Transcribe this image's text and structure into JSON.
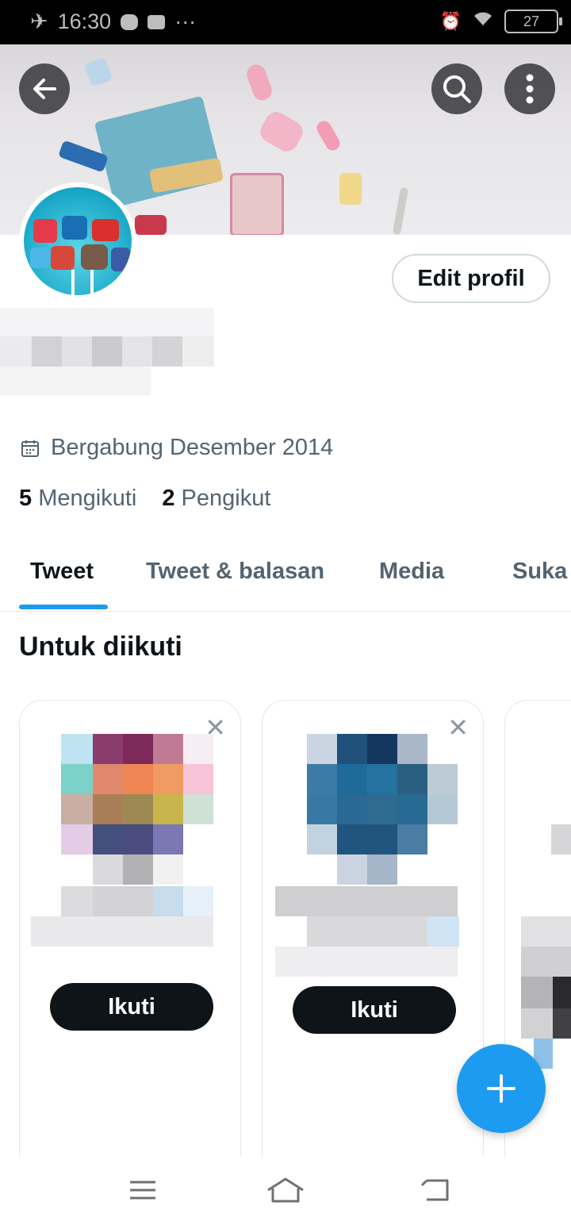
{
  "status_bar": {
    "time": "16:30",
    "dots": "···",
    "battery": "27"
  },
  "header": {
    "edit_profile_label": "Edit profil"
  },
  "profile": {
    "joined": "Bergabung Desember 2014",
    "following_count": "5",
    "following_label": "Mengikuti",
    "followers_count": "2",
    "followers_label": "Pengikut"
  },
  "tabs": [
    {
      "label": "Tweet",
      "active": true
    },
    {
      "label": "Tweet & balasan",
      "active": false
    },
    {
      "label": "Media",
      "active": false
    },
    {
      "label": "Suka",
      "active": false
    }
  ],
  "suggestions": {
    "title": "Untuk diikuti",
    "cards": [
      {
        "follow_label": "Ikuti",
        "close": "✕"
      },
      {
        "follow_label": "Ikuti",
        "close": "✕"
      }
    ]
  },
  "colors": {
    "accent": "#1d9bf0",
    "text": "#0f1419",
    "muted": "#536471"
  },
  "icons": {
    "back": "arrow-left-icon",
    "search": "search-icon",
    "more": "more-vertical-icon",
    "calendar": "calendar-icon",
    "compose": "plus-icon"
  }
}
